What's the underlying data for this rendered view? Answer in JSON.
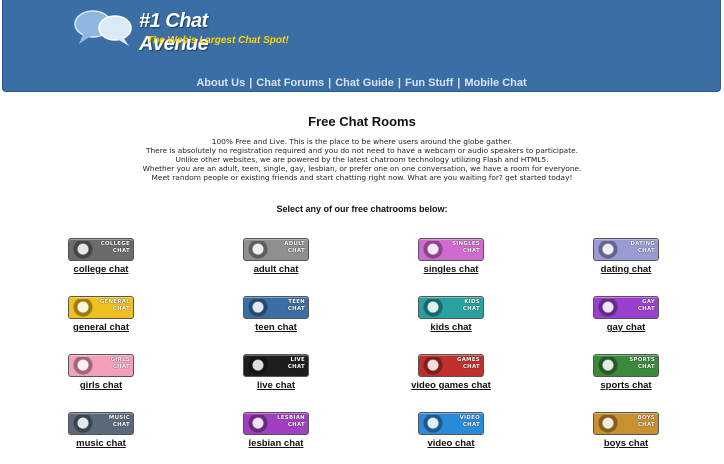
{
  "header": {
    "logo_title": "#1 Chat Avenue",
    "logo_tagline": "The Web's Largest Chat Spot!",
    "nav": [
      "About Us",
      "Chat Forums",
      "Chat Guide",
      "Fun Stuff",
      "Mobile Chat"
    ]
  },
  "main": {
    "title": "Free Chat Rooms",
    "intro_lines": [
      "100% Free and Live. This is the place to be where users around the globe gather.",
      "There is absolutely no registration required and you do not need to have a webcam or audio speakers to participate.",
      "Unlike other websites, we are powered by the latest chatroom technology utilizing Flash and HTML5.",
      "Whether you are an adult, teen, single, gay, lesbian, or prefer one on one conversation, we have a room for everyone.",
      "Meet random people or existing friends and start chatting right now. What are you waiting for? get started today!"
    ],
    "select_label": "Select any of our free chatrooms below:"
  },
  "rooms": [
    {
      "label": "college chat",
      "badge1": "COLLEGE",
      "badge2": "CHAT",
      "color": "#6b6b6b",
      "icon": "graduation-cap-icon"
    },
    {
      "label": "adult chat",
      "badge1": "ADULT",
      "badge2": "CHAT",
      "color": "#8f8f8f",
      "icon": "adult-figure-icon"
    },
    {
      "label": "singles chat",
      "badge1": "SINGLES",
      "badge2": "CHAT",
      "color": "#d06ad0",
      "icon": "couple-icon"
    },
    {
      "label": "dating chat",
      "badge1": "DATING",
      "badge2": "CHAT",
      "color": "#9a9ad4",
      "icon": "dating-couple-icon"
    },
    {
      "label": "general chat",
      "badge1": "GENERAL",
      "badge2": "CHAT",
      "color": "#f0c020",
      "icon": "chat-bubbles-icon"
    },
    {
      "label": "teen chat",
      "badge1": "TEEN",
      "badge2": "CHAT",
      "color": "#3a6ea5",
      "icon": "sunglasses-icon"
    },
    {
      "label": "kids chat",
      "badge1": "KIDS",
      "badge2": "CHAT",
      "color": "#2aa0a0",
      "icon": "kids-icon"
    },
    {
      "label": "gay chat",
      "badge1": "GAY",
      "badge2": "CHAT",
      "color": "#9b3fcf",
      "icon": "rainbow-icon"
    },
    {
      "label": "girls chat",
      "badge1": "GIRLS",
      "badge2": "CHAT",
      "color": "#f4a0b8",
      "icon": "flowers-icon"
    },
    {
      "label": "live chat",
      "badge1": "LIVE",
      "badge2": "CHAT",
      "color": "#1e1e1e",
      "icon": "live-bubbles-icon"
    },
    {
      "label": "video games chat",
      "badge1": "GAMES",
      "badge2": "CHAT",
      "color": "#c0302a",
      "icon": "game-controller-icon"
    },
    {
      "label": "sports chat",
      "badge1": "SPORTS",
      "badge2": "CHAT",
      "color": "#3a8a3a",
      "icon": "sports-balls-icon"
    },
    {
      "label": "music chat",
      "badge1": "MUSIC",
      "badge2": "CHAT",
      "color": "#5a6a7a",
      "icon": "speaker-icon"
    },
    {
      "label": "lesbian chat",
      "badge1": "LESBIAN",
      "badge2": "CHAT",
      "color": "#a040c0",
      "icon": "female-symbols-icon"
    },
    {
      "label": "video chat",
      "badge1": "VIDEO",
      "badge2": "CHAT",
      "color": "#2a8ad8",
      "icon": "webcam-icon"
    },
    {
      "label": "boys chat",
      "badge1": "BOYS",
      "badge2": "CHAT",
      "color": "#c89030",
      "icon": "boys-icon"
    }
  ]
}
